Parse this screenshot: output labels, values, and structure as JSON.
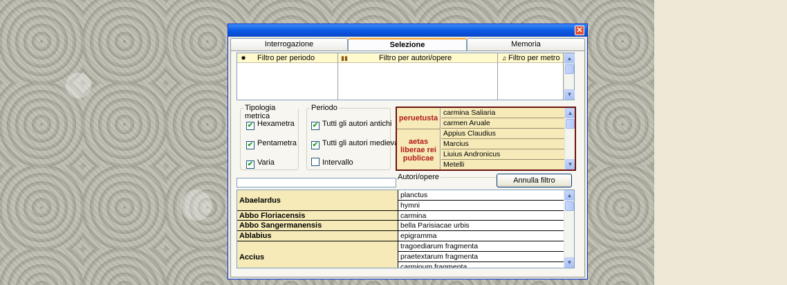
{
  "window": {
    "close_label": "✕",
    "tabs": [
      {
        "label": "Interrogazione"
      },
      {
        "label": "Selezione"
      },
      {
        "label": "Memoria"
      }
    ]
  },
  "filters": {
    "period": {
      "label": "Filtro per periodo",
      "icon": "sun-icon"
    },
    "authors": {
      "label": "Filtro per autori/opere",
      "icon": "books-icon"
    },
    "meter": {
      "label": "Filtro per metro",
      "icon": "music-note-icon"
    }
  },
  "tipologia": {
    "title": "Tipologia metrica",
    "options": [
      {
        "label": "Hexametra",
        "checked": true
      },
      {
        "label": "Pentametra",
        "checked": true
      },
      {
        "label": "Varia",
        "checked": true
      }
    ]
  },
  "periodo": {
    "title": "Periodo",
    "options": [
      {
        "label": "Tutti gli autori antichi",
        "checked": true
      },
      {
        "label": "Tutti gli autori medievali",
        "checked": true
      },
      {
        "label": "Intervallo",
        "checked": false
      }
    ]
  },
  "period_table": {
    "groups": [
      "peruetusta",
      "aetas liberae rei publicae"
    ],
    "items": [
      "carmina Saliaria",
      "carmen Aruale",
      "Appius Claudius",
      "Marcius",
      "Liuius Andronicus",
      "Metelli"
    ]
  },
  "authors": {
    "search_value": "",
    "group_title": "Autori/opere",
    "annulla_label": "Annulla filtro",
    "rows": [
      {
        "author": "Abaelardus",
        "works": [
          "planctus",
          "hymni"
        ]
      },
      {
        "author": "Abbo Floriacensis",
        "works": [
          "carmina"
        ]
      },
      {
        "author": "Abbo Sangermanensis",
        "works": [
          "bella Parisiacae urbis"
        ]
      },
      {
        "author": "Ablabius",
        "works": [
          "epigramma"
        ]
      },
      {
        "author": "Accius",
        "works": [
          "tragoediarum fragmenta",
          "praetextarum fragmenta",
          "carminum fragmenta"
        ]
      }
    ]
  },
  "scroll": {
    "up": "▲",
    "down": "▼"
  },
  "check_mark": "✔"
}
